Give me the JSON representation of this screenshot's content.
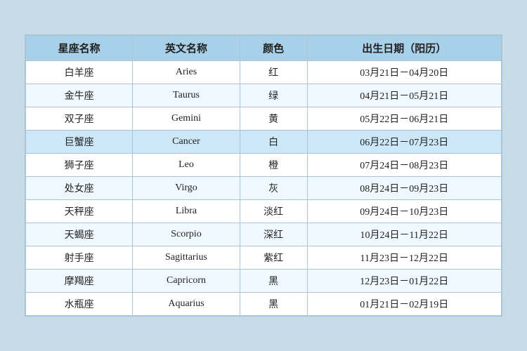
{
  "table": {
    "headers": [
      "星座名称",
      "英文名称",
      "颜色",
      "出生日期（阳历）"
    ],
    "rows": [
      {
        "chinese": "白羊座",
        "english": "Aries",
        "color": "红",
        "dates": "03月21日－04月20日",
        "highlight": false
      },
      {
        "chinese": "金牛座",
        "english": "Taurus",
        "color": "绿",
        "dates": "04月21日－05月21日",
        "highlight": false
      },
      {
        "chinese": "双子座",
        "english": "Gemini",
        "color": "黄",
        "dates": "05月22日－06月21日",
        "highlight": false
      },
      {
        "chinese": "巨蟹座",
        "english": "Cancer",
        "color": "白",
        "dates": "06月22日－07月23日",
        "highlight": true
      },
      {
        "chinese": "狮子座",
        "english": "Leo",
        "color": "橙",
        "dates": "07月24日－08月23日",
        "highlight": false
      },
      {
        "chinese": "处女座",
        "english": "Virgo",
        "color": "灰",
        "dates": "08月24日－09月23日",
        "highlight": false
      },
      {
        "chinese": "天秤座",
        "english": "Libra",
        "color": "淡红",
        "dates": "09月24日－10月23日",
        "highlight": false
      },
      {
        "chinese": "天蝎座",
        "english": "Scorpio",
        "color": "深红",
        "dates": "10月24日－11月22日",
        "highlight": false
      },
      {
        "chinese": "射手座",
        "english": "Sagittarius",
        "color": "紫红",
        "dates": "11月23日－12月22日",
        "highlight": false
      },
      {
        "chinese": "摩羯座",
        "english": "Capricorn",
        "color": "黑",
        "dates": "12月23日－01月22日",
        "highlight": false
      },
      {
        "chinese": "水瓶座",
        "english": "Aquarius",
        "color": "黑",
        "dates": "01月21日－02月19日",
        "highlight": false
      }
    ]
  }
}
